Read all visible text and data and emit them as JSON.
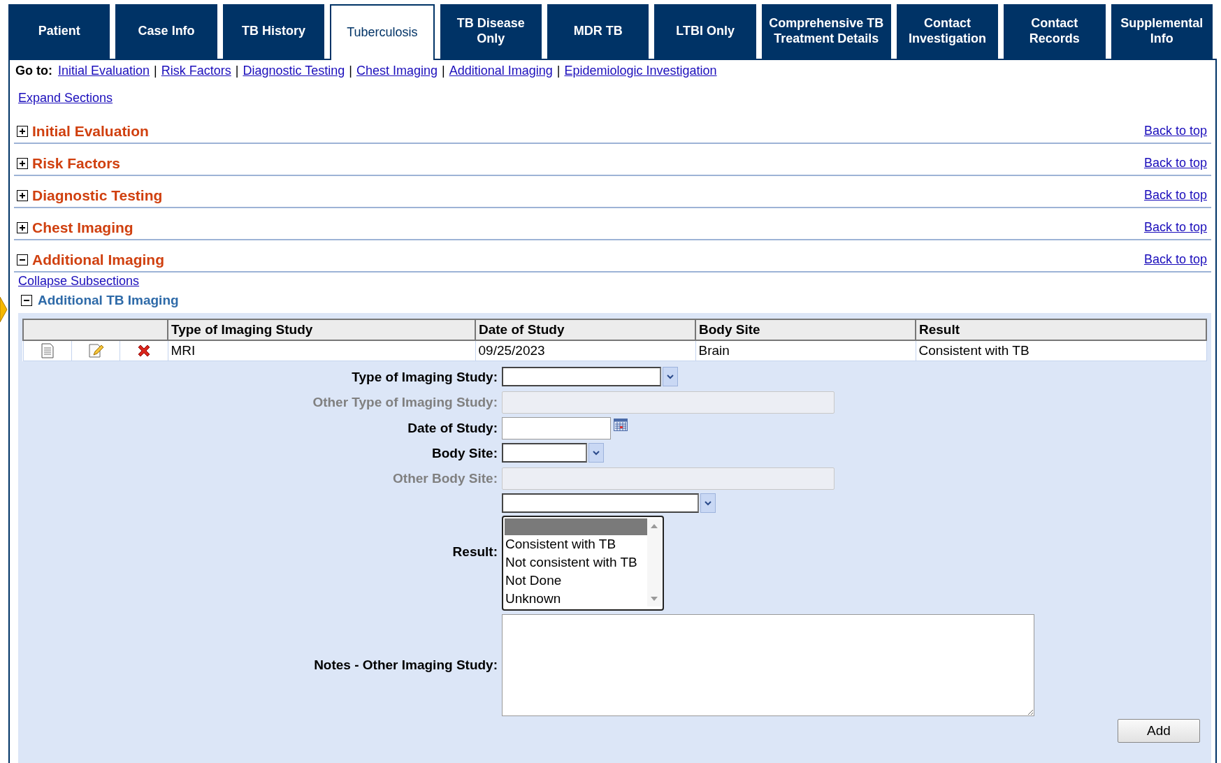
{
  "tabs": [
    {
      "label": "Patient",
      "selected": false
    },
    {
      "label": "Case Info",
      "selected": false
    },
    {
      "label": "TB History",
      "selected": false
    },
    {
      "label": "Tuberculosis",
      "selected": true
    },
    {
      "label": "TB Disease Only",
      "selected": false
    },
    {
      "label": "MDR TB",
      "selected": false
    },
    {
      "label": "LTBI Only",
      "selected": false
    },
    {
      "label": "Comprehensive TB Treatment Details",
      "selected": false
    },
    {
      "label": "Contact Investigation",
      "selected": false
    },
    {
      "label": "Contact Records",
      "selected": false
    },
    {
      "label": "Supplemental Info",
      "selected": false
    }
  ],
  "goto": {
    "label": "Go to:",
    "separator": "|",
    "links": [
      "Initial Evaluation",
      "Risk Factors",
      "Diagnostic Testing",
      "Chest Imaging",
      "Additional Imaging",
      "Epidemiologic Investigation"
    ]
  },
  "expand_link": "Expand Sections",
  "sections": [
    {
      "title": "Initial Evaluation",
      "expanded": false,
      "back_link": "Back to top"
    },
    {
      "title": "Risk Factors",
      "expanded": false,
      "back_link": "Back to top"
    },
    {
      "title": "Diagnostic Testing",
      "expanded": false,
      "back_link": "Back to top"
    },
    {
      "title": "Chest Imaging",
      "expanded": false,
      "back_link": "Back to top"
    },
    {
      "title": "Additional Imaging",
      "expanded": true,
      "back_link": "Back to top"
    }
  ],
  "subsection": {
    "collapse_link": "Collapse Subsections",
    "title": "Additional TB Imaging",
    "expanded": true,
    "table": {
      "columns": [
        "Type of Imaging Study",
        "Date of Study",
        "Body Site",
        "Result"
      ],
      "rows": [
        {
          "cells": [
            "MRI",
            "09/25/2023",
            "Brain",
            "Consistent with TB"
          ]
        }
      ]
    },
    "form": [
      {
        "kind": "select",
        "label": "Type of Imaging Study:",
        "disabled": false
      },
      {
        "kind": "text",
        "label": "Other Type of Imaging Study:",
        "disabled": true
      },
      {
        "kind": "date",
        "label": "Date of Study:",
        "disabled": false
      },
      {
        "kind": "select_small",
        "label": "Body Site:",
        "disabled": false
      },
      {
        "kind": "text",
        "label": "Other Body Site:",
        "disabled": true
      },
      {
        "kind": "open_select",
        "label": "Result:",
        "disabled": false,
        "options": [
          "Consistent with TB",
          "Not consistent with TB",
          "Not Done",
          "Unknown"
        ]
      },
      {
        "kind": "textarea",
        "label": "Notes - Other Imaging Study:",
        "disabled": false
      }
    ],
    "add_button": "Add"
  }
}
